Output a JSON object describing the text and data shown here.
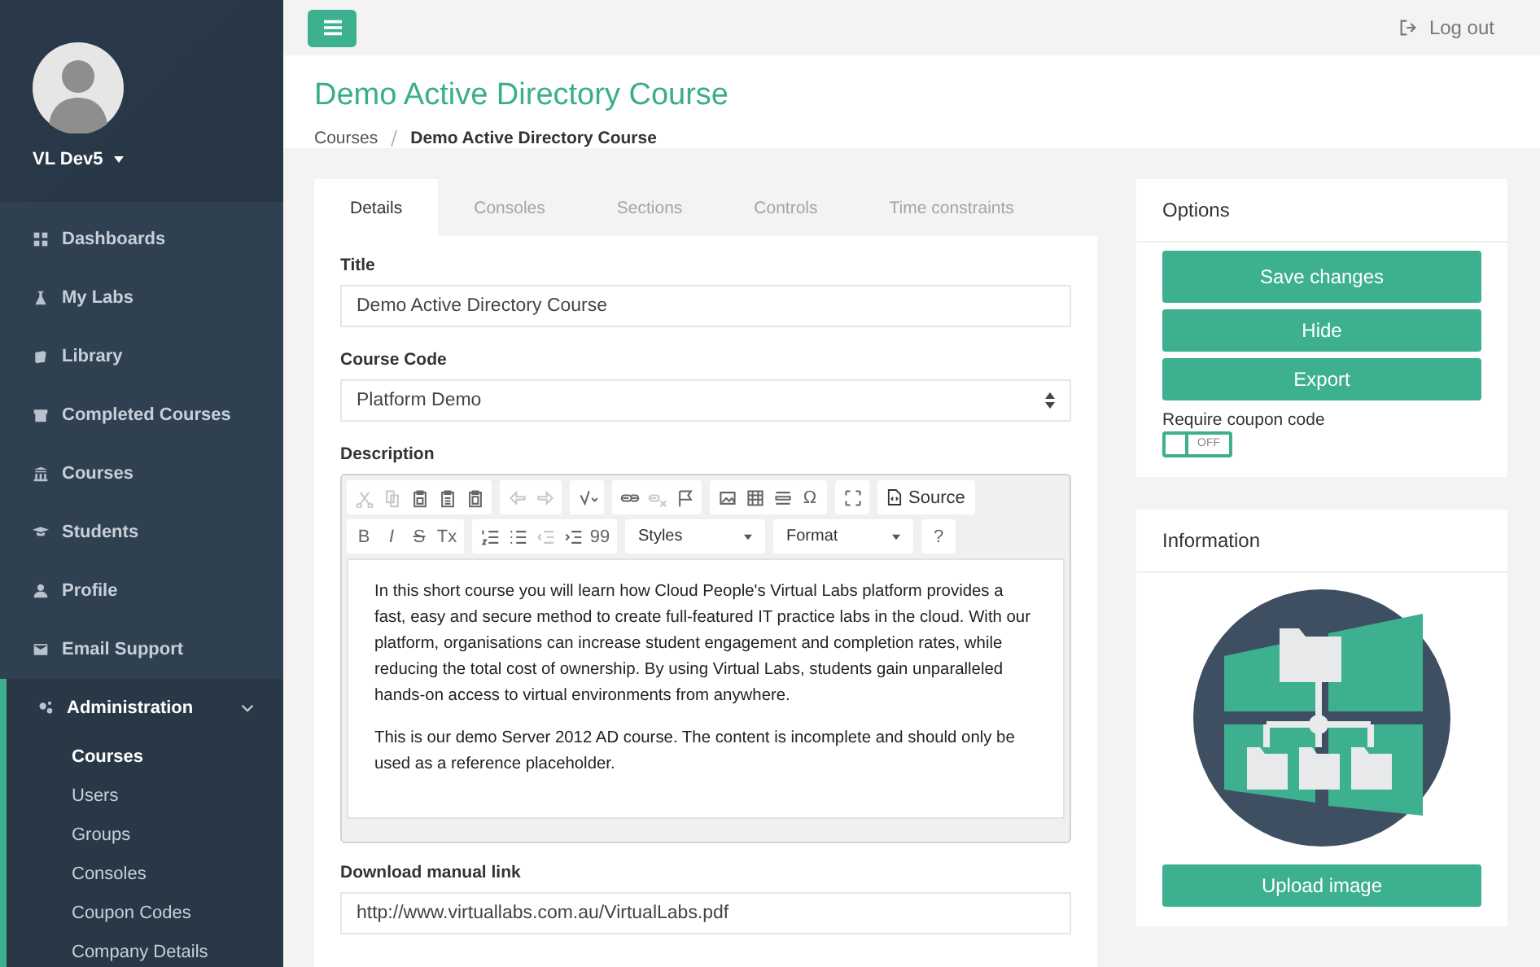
{
  "user": {
    "name": "VL Dev5"
  },
  "nav": [
    {
      "label": "Dashboards",
      "selected": false
    },
    {
      "label": "My Labs",
      "selected": false
    },
    {
      "label": "Library",
      "selected": false
    },
    {
      "label": "Completed Courses",
      "selected": false
    },
    {
      "label": "Courses",
      "selected": false
    },
    {
      "label": "Students",
      "selected": false
    },
    {
      "label": "Profile",
      "selected": false
    },
    {
      "label": "Email Support",
      "selected": false
    },
    {
      "label": "Administration",
      "selected": true,
      "expanded": true,
      "children": [
        {
          "label": "Courses",
          "selected": true
        },
        {
          "label": "Users",
          "selected": false
        },
        {
          "label": "Groups",
          "selected": false
        },
        {
          "label": "Consoles",
          "selected": false
        },
        {
          "label": "Coupon Codes",
          "selected": false
        },
        {
          "label": "Company Details",
          "selected": false
        }
      ]
    }
  ],
  "topbar": {
    "logout": "Log out"
  },
  "header": {
    "title": "Demo Active Directory Course",
    "breadcrumb": [
      "Courses",
      "Demo Active Directory Course"
    ]
  },
  "tabs": [
    {
      "label": "Details",
      "selected": true
    },
    {
      "label": "Consoles",
      "selected": false
    },
    {
      "label": "Sections",
      "selected": false
    },
    {
      "label": "Controls",
      "selected": false
    },
    {
      "label": "Time constraints",
      "selected": false
    }
  ],
  "form": {
    "title_label": "Title",
    "title_value": "Demo Active Directory Course",
    "code_label": "Course Code",
    "code_value": "Platform Demo",
    "description_label": "Description",
    "download_label": "Download manual link",
    "download_value": "http://www.virtuallabs.com.au/VirtualLabs.pdf"
  },
  "editor": {
    "toolbar": [
      [
        [
          {
            "kind": "icon",
            "disabled": true
          },
          {
            "kind": "icon",
            "disabled": true
          },
          {
            "kind": "icon",
            "disabled": false
          },
          {
            "kind": "icon",
            "disabled": false
          },
          {
            "kind": "icon",
            "disabled": false
          }
        ],
        [
          {
            "kind": "icon",
            "disabled": true
          },
          {
            "kind": "icon",
            "disabled": true
          }
        ],
        [
          {
            "kind": "icon",
            "disabled": false
          }
        ],
        [
          {
            "kind": "icon",
            "disabled": false
          },
          {
            "kind": "icon",
            "disabled": true
          },
          {
            "kind": "icon",
            "disabled": false
          }
        ],
        [
          {
            "kind": "icon",
            "disabled": false
          },
          {
            "kind": "icon",
            "disabled": false
          },
          {
            "kind": "icon",
            "disabled": false
          },
          {
            "kind": "glyph",
            "text": "Ω",
            "disabled": false
          }
        ],
        [
          {
            "kind": "icon",
            "disabled": false
          }
        ],
        [
          {
            "kind": "labeled",
            "label": "Source",
            "disabled": false
          }
        ]
      ],
      [
        [
          {
            "kind": "glyph",
            "text": "B",
            "disabled": false
          },
          {
            "kind": "glyph",
            "text": "I",
            "disabled": false
          },
          {
            "kind": "glyph",
            "text": "S",
            "disabled": false
          },
          {
            "kind": "glyph",
            "text": "Tx",
            "disabled": false
          }
        ],
        [
          {
            "kind": "icon",
            "disabled": false
          },
          {
            "kind": "icon",
            "disabled": false
          },
          {
            "kind": "icon",
            "disabled": true
          },
          {
            "kind": "icon",
            "disabled": false
          },
          {
            "kind": "glyph",
            "text": "99",
            "disabled": false
          }
        ],
        [
          {
            "kind": "combo",
            "label": "Styles",
            "disabled": false
          }
        ],
        [
          {
            "kind": "combo",
            "label": "Format",
            "disabled": false
          }
        ],
        [
          {
            "kind": "glyph",
            "text": "?",
            "disabled": false
          }
        ]
      ]
    ],
    "paragraphs": [
      "In this short course you will learn how Cloud People's Virtual Labs platform provides a fast, easy and secure method to create full-featured IT practice labs in the cloud. With our platform, organisations can increase student engagement and completion rates, while reducing the total cost of ownership. By using Virtual Labs, students gain unparalleled hands-on access to virtual environments from anywhere.",
      "This is our demo Server 2012 AD course. The content is incomplete and should only be used as a reference placeholder."
    ]
  },
  "options": {
    "title": "Options",
    "buttons": [
      "Save changes",
      "Hide",
      "Export"
    ],
    "coupon_label": "Require coupon code",
    "coupon": {
      "on": false,
      "text": "OFF"
    }
  },
  "information": {
    "title": "Information",
    "upload": "Upload image"
  }
}
